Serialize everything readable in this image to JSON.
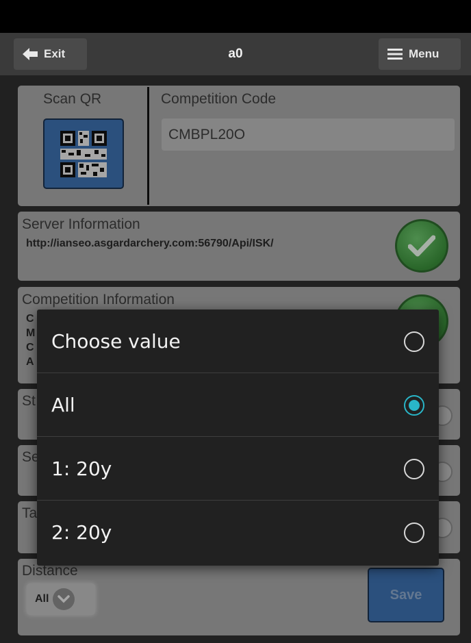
{
  "header": {
    "exit_label": "Exit",
    "title": "a0",
    "menu_label": "Menu"
  },
  "qr": {
    "scan_label": "Scan QR"
  },
  "competition_code": {
    "label": "Competition Code",
    "value": "CMBPL20O"
  },
  "server": {
    "label": "Server Information",
    "url": "http://ianseo.asgardarchery.com:56790/Api/ISK/"
  },
  "competition_info": {
    "label": "Competition Information",
    "line_initials": [
      "C",
      "M",
      "C",
      "A"
    ]
  },
  "partial_labels": {
    "stage": "St",
    "session": "Se",
    "target": "Ta"
  },
  "distance": {
    "label": "Distance",
    "selected": "All",
    "save_label": "Save"
  },
  "dialog": {
    "options": [
      {
        "label": "Choose value",
        "selected": false
      },
      {
        "label": "All",
        "selected": true
      },
      {
        "label": "1: 20y",
        "selected": false
      },
      {
        "label": "2: 20y",
        "selected": false
      }
    ]
  },
  "colors": {
    "accent": "#29b6c8",
    "button_blue": "#3c6fae",
    "success_green": "#3a8e3a",
    "panel_gray": "#a5a5a5"
  }
}
